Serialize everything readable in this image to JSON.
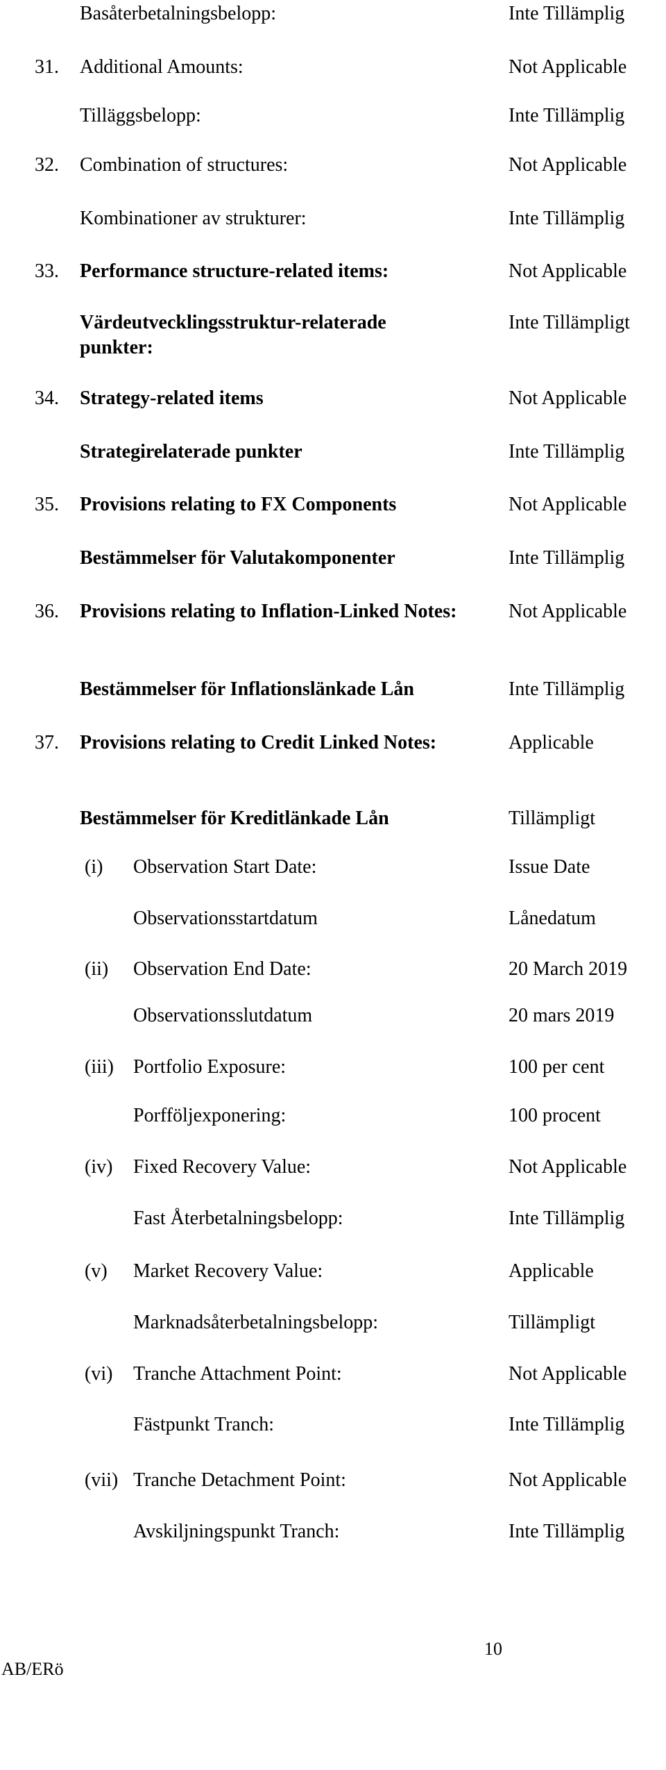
{
  "rows": [
    {
      "label": "Basåterbetalningsbelopp:",
      "value": "Inte Tillämplig"
    },
    {
      "num": "31.",
      "label": "Additional Amounts:",
      "value": "Not Applicable"
    },
    {
      "label": "Tilläggsbelopp:",
      "value": "Inte Tillämplig"
    },
    {
      "num": "32.",
      "label": "Combination of structures:",
      "value": "Not Applicable"
    },
    {
      "label": "Kombinationer av strukturer:",
      "value": "Inte Tillämplig"
    },
    {
      "num": "33.",
      "label": "Performance structure-related items:",
      "value": "Not Applicable"
    },
    {
      "label": "Värdeutvecklingsstruktur-relaterade punkter:",
      "value": "Inte Tillämpligt"
    },
    {
      "num": "34.",
      "label": "Strategy-related items",
      "value": "Not Applicable"
    },
    {
      "label": "Strategirelaterade punkter",
      "value": "Inte Tillämplig"
    },
    {
      "num": "35.",
      "label": "Provisions relating to FX Components",
      "value": "Not Applicable"
    },
    {
      "label": "Bestämmelser för Valutakomponenter",
      "value": "Inte Tillämplig"
    },
    {
      "num": "36.",
      "label": "Provisions relating to Inflation-Linked Notes:",
      "value": "Not Applicable"
    },
    {
      "label": "Bestämmelser för Inflationslänkade Lån",
      "value": "Inte Tillämplig"
    },
    {
      "num": "37.",
      "label": "Provisions relating to Credit Linked Notes:",
      "value": "Applicable"
    },
    {
      "label": "Bestämmelser för Kreditlänkade Lån",
      "value": "Tillämpligt"
    }
  ],
  "subitems": [
    {
      "num": "(i)",
      "label": "Observation Start Date:",
      "value": "Issue Date",
      "label_sv": "Observationsstartdatum",
      "value_sv": "Lånedatum"
    },
    {
      "num": "(ii)",
      "label": "Observation End Date:",
      "value": "20 March 2019",
      "label_sv": "Observationsslutdatum",
      "value_sv": "20 mars 2019"
    },
    {
      "num": "(iii)",
      "label": "Portfolio Exposure:",
      "value": "100 per cent",
      "label_sv": "Porfföljexponering:",
      "value_sv": "100 procent"
    },
    {
      "num": "(iv)",
      "label": "Fixed Recovery Value:",
      "value": "Not Applicable",
      "label_sv": "Fast Återbetalningsbelopp:",
      "value_sv": "Inte Tillämplig"
    },
    {
      "num": "(v)",
      "label": "Market Recovery Value:",
      "value": "Applicable",
      "label_sv": "Marknadsåterbetalningsbelopp:",
      "value_sv": "Tillämpligt"
    },
    {
      "num": "(vi)",
      "label": "Tranche Attachment Point:",
      "value": "Not Applicable",
      "label_sv": "Fästpunkt Tranch:",
      "value_sv": "Inte Tillämplig"
    },
    {
      "num": "(vii)",
      "label": "Tranche Detachment Point:",
      "value": "Not Applicable",
      "label_sv": "Avskiljningspunkt Tranch:",
      "value_sv": "Inte Tillämplig"
    }
  ],
  "footer": {
    "page_number": "10",
    "initials": "AB/ERö"
  }
}
